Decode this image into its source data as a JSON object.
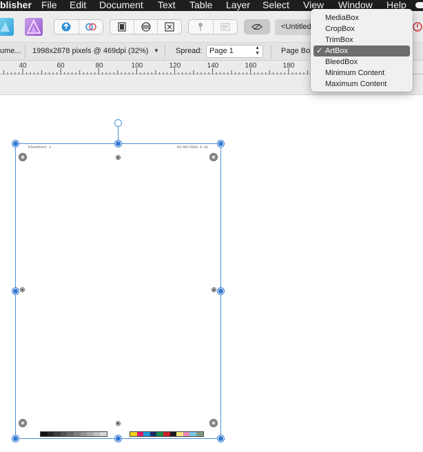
{
  "menubar": {
    "app_name": "blisher",
    "items": [
      "File",
      "Edit",
      "Document",
      "Text",
      "Table",
      "Layer",
      "Select",
      "View",
      "Window",
      "Help"
    ]
  },
  "toolbar": {
    "document_title": "<Untitled",
    "icons": [
      "designer-persona-icon",
      "publisher-persona-icon",
      "share-icon",
      "affinity-link-icon",
      "page-icon",
      "spread-icon",
      "master-icon",
      "pin-icon",
      "text-frame-icon",
      "preview-icon",
      "alert-icon"
    ]
  },
  "context": {
    "document_label": "ume...",
    "size_info": "1998x2878 pixels @ 469dpi (32%)",
    "spread_label": "Spread:",
    "spread_value": "Page 1",
    "pagebox_label": "Page Box"
  },
  "ruler": {
    "labels": [
      "40",
      "60",
      "80",
      "100",
      "120",
      "140",
      "160",
      "180"
    ]
  },
  "page": {
    "slug_left": "bleedtest 1",
    "slug_right": "01/06/2020 9.33",
    "gray_swatches": [
      "#111111",
      "#262626",
      "#3c3c3c",
      "#525252",
      "#686868",
      "#7e7e7e",
      "#949494",
      "#aaaaaa",
      "#c0c0c0",
      "#d6d6d6"
    ],
    "color_swatches": [
      "#f0d11c",
      "#d81b74",
      "#1c9ad6",
      "#1f2e6b",
      "#1b8b4e",
      "#c9202a",
      "#1a1a1a",
      "#f2ea7a",
      "#e48ab8",
      "#7cc6e8",
      "#7f9a84"
    ]
  },
  "dropdown": {
    "items": [
      "MediaBox",
      "CropBox",
      "TrimBox",
      "ArtBox",
      "BleedBox",
      "Minimum Content",
      "Maximum Content"
    ],
    "selected": "ArtBox",
    "check": "✓"
  },
  "colors": {
    "selection": "#2f77d0",
    "menu_highlight": "#6d6d6d"
  }
}
